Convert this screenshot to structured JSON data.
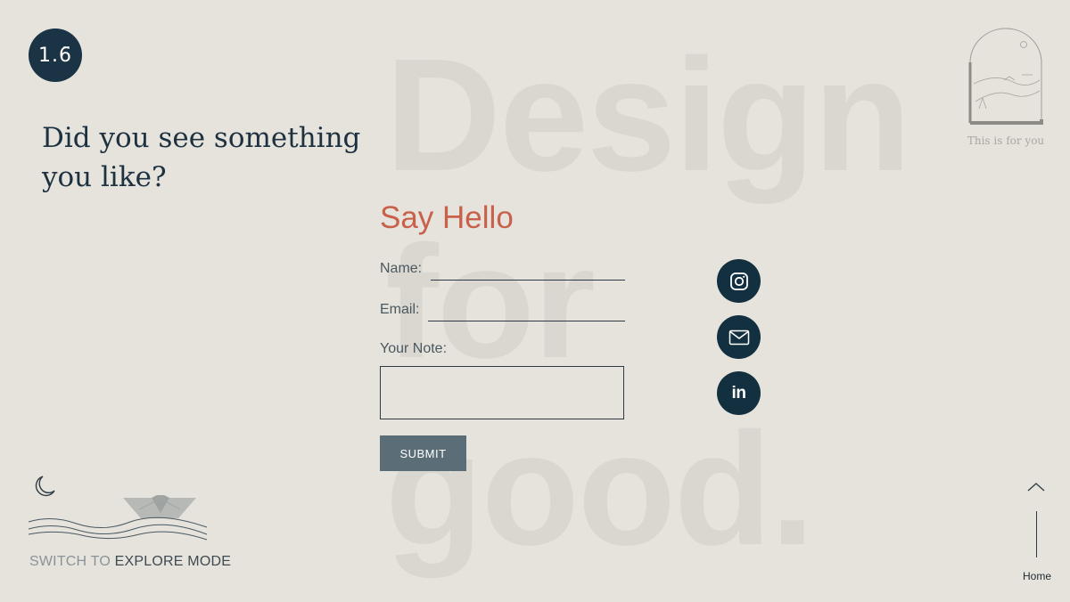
{
  "logo": {
    "text": "1.6̈"
  },
  "background_words": [
    "Design",
    "for",
    "good."
  ],
  "headline": "Did you see something you like?",
  "illustration": {
    "caption": "This is for you"
  },
  "form": {
    "title": "Say Hello",
    "name_label": "Name:",
    "name_value": "",
    "email_label": "Email:",
    "email_value": "",
    "note_label": "Your Note:",
    "note_value": "",
    "submit_label": "SUBMIT"
  },
  "social": {
    "items": [
      {
        "icon": "instagram-icon"
      },
      {
        "icon": "mail-icon"
      },
      {
        "icon": "linkedin-icon",
        "glyph": "in"
      }
    ]
  },
  "mode_switch": {
    "prefix": "SWITCH TO",
    "emphasis": "EXPLORE MODE",
    "icon": "moon-icon"
  },
  "nav": {
    "home_label": "Home",
    "up_icon": "chevron-up-icon"
  },
  "colors": {
    "background": "#e5e3dc",
    "navy": "#12303f",
    "accent": "#c8604a",
    "button": "#5b6e78"
  }
}
